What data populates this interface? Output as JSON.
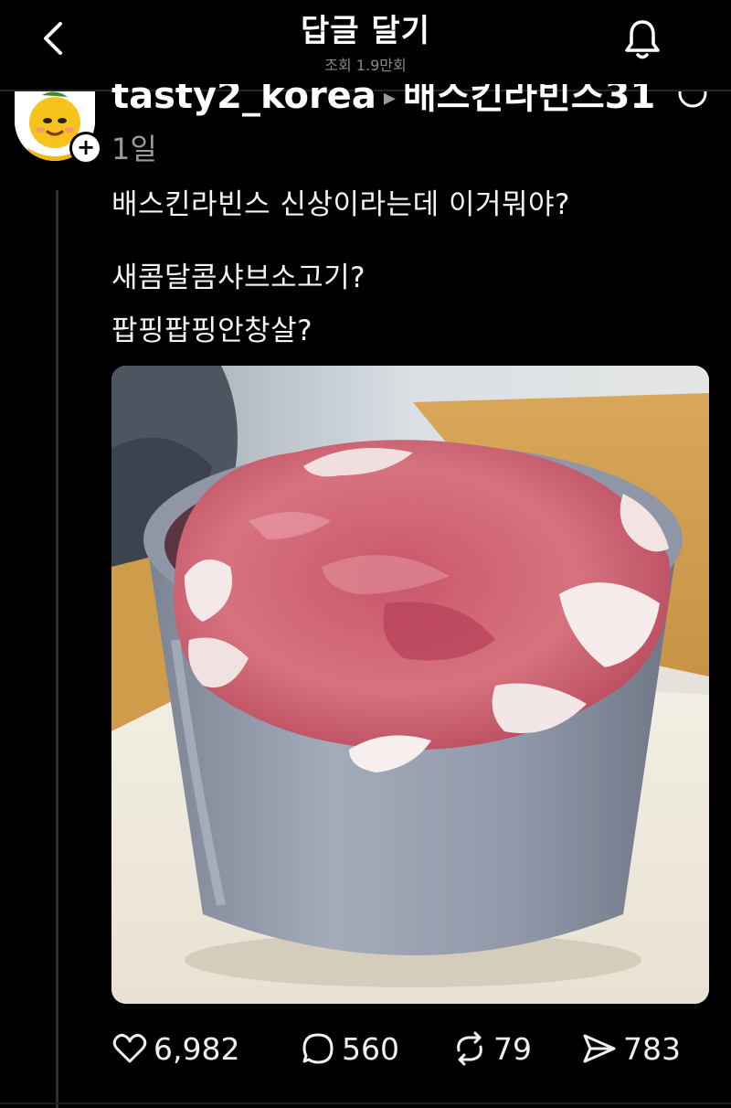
{
  "header": {
    "title": "답글 달기",
    "views": "조회 1.9만회"
  },
  "post": {
    "username": "tasty2_korea",
    "reply_target": "배스킨라빈스31",
    "time": "1일",
    "follow_badge": "+",
    "lines": [
      "배스킨라빈스 신상이라는데 이거뭐야?",
      "새콤달콤샤브소고기?",
      "팝핑팝핑안창살?"
    ]
  },
  "actions": {
    "likes": "6,982",
    "replies": "560",
    "reposts": "79",
    "shares": "783"
  },
  "colors": {
    "background": "#000000",
    "text": "#f2f2f2",
    "muted": "#8a8a8a"
  },
  "icons": [
    "back-chevron-icon",
    "bell-icon",
    "heart-icon",
    "comment-icon",
    "repost-icon",
    "share-icon"
  ]
}
